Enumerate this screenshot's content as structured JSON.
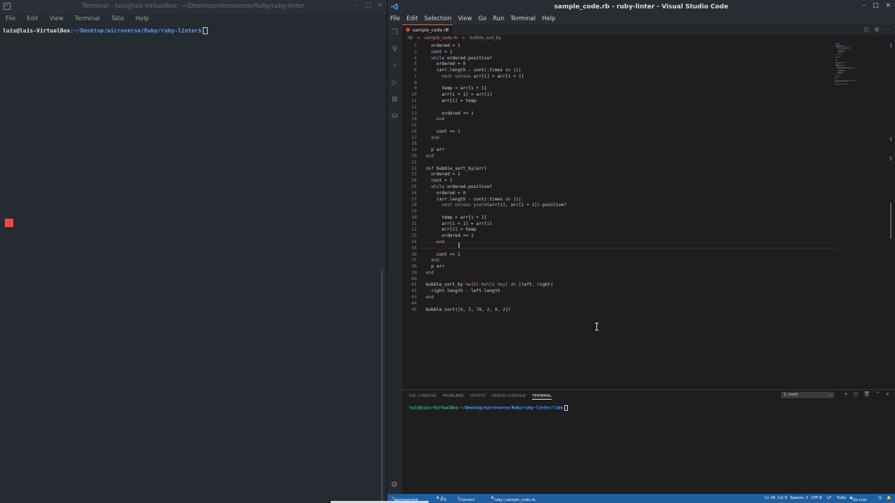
{
  "terminal_window": {
    "title": "Terminal - luis@luis-VirtualBox: ~/Desktop/microverse/Ruby/ruby-linter",
    "menu": [
      "File",
      "Edit",
      "View",
      "Terminal",
      "Tabs",
      "Help"
    ],
    "prompt_user": "luis@luis-VirtualBox",
    "prompt_path": ":~/Desktop/microverse/Ruby/ruby-linter$"
  },
  "vscode": {
    "title": "sample_code.rb - ruby-linter - Visual Studio Code",
    "menu": [
      "File",
      "Edit",
      "Selection",
      "View",
      "Go",
      "Run",
      "Terminal",
      "Help"
    ],
    "tab_label": "sample_code.rb",
    "tab_close": "×",
    "breadcrumb": [
      "lib",
      ">",
      "sample_code.rb",
      ">",
      "bubble_sort_by"
    ],
    "code_lines": [
      {
        "n": "2",
        "t": "  ordered = 1"
      },
      {
        "n": "3",
        "t": "  cont = 1"
      },
      {
        "n": "4",
        "t": "  while ordered.positive?"
      },
      {
        "n": "5",
        "t": "    ordered = 0"
      },
      {
        "n": "6",
        "t": "    (arr.length - cont).times do |i|"
      },
      {
        "n": "7",
        "t": "      next unless arr[i] > arr[i + 1]"
      },
      {
        "n": "8",
        "t": ""
      },
      {
        "n": "9",
        "t": "      temp = arr[i + 1]"
      },
      {
        "n": "10",
        "t": "      arr[i + 1] = arr[i]"
      },
      {
        "n": "11",
        "t": "      arr[i] = temp"
      },
      {
        "n": "12",
        "t": ""
      },
      {
        "n": "13",
        "t": "      ordered += 1"
      },
      {
        "n": "14",
        "t": "    end"
      },
      {
        "n": "15",
        "t": ""
      },
      {
        "n": "16",
        "t": "    cont += 1"
      },
      {
        "n": "17",
        "t": "  end"
      },
      {
        "n": "18",
        "t": ""
      },
      {
        "n": "19",
        "t": "  p arr"
      },
      {
        "n": "20",
        "t": "end"
      },
      {
        "n": "21",
        "t": ""
      },
      {
        "n": "22",
        "t": "def bubble_sort_by(arr)"
      },
      {
        "n": "23",
        "t": "  ordered = 1"
      },
      {
        "n": "24",
        "t": "  cont = 1"
      },
      {
        "n": "25",
        "t": "  while ordered.positive?"
      },
      {
        "n": "26",
        "t": "    ordered = 0"
      },
      {
        "n": "27",
        "t": "    (arr.length - cont).times do |i|"
      },
      {
        "n": "28",
        "t": "      next unless yield(arr[i], arr[i + 1]).positive?"
      },
      {
        "n": "29",
        "t": ""
      },
      {
        "n": "30",
        "t": "      temp = arr[i + 1]"
      },
      {
        "n": "31",
        "t": "      arr[i + 1] = arr[i]"
      },
      {
        "n": "32",
        "t": "      arr[i] = temp"
      },
      {
        "n": "33",
        "t": "      ordered += 1"
      },
      {
        "n": "34",
        "t": "    end"
      },
      {
        "n": "35",
        "t": ""
      },
      {
        "n": "36",
        "t": "    cont += 1"
      },
      {
        "n": "37",
        "t": "  end"
      },
      {
        "n": "38",
        "t": "  p arr"
      },
      {
        "n": "39",
        "t": "end"
      },
      {
        "n": "40",
        "t": ""
      },
      {
        "n": "41",
        "t": "bubble_sort_by %w[hi hello hey] do |left, right|"
      },
      {
        "n": "42",
        "t": "  right.length - left.length"
      },
      {
        "n": "43",
        "t": "end"
      },
      {
        "n": "44",
        "t": ""
      },
      {
        "n": "45",
        "t": "bubble_sort([4, 3, 78, 2, 0, 2])"
      }
    ],
    "panel": {
      "tabs": [
        "SQL CONSOLE",
        "PROBLEMS",
        "OUTPUT",
        "DEBUG CONSOLE",
        "TERMINAL"
      ],
      "terminal_select": "1: bash",
      "prompt_user": "luis@luis-VirtualBox",
      "prompt_path": ":~/Desktop/microverse/Ruby/ruby-linter/lib$"
    },
    "status": {
      "branch": "development",
      "errors": "0",
      "warnings": "0",
      "connect": "Connect",
      "lang_file": "ruby | sample_code.rb",
      "position": "Ln 34, Col 8",
      "spaces": "Spaces: 2",
      "encoding": "UTF-8",
      "eol": "LF",
      "language": "Ruby",
      "golive": "Go Live"
    }
  },
  "colors": {
    "accent_status": "#1f5fa0",
    "keyword": "#c586c0",
    "function": "#dcdcaa",
    "variable": "#9cdcfe",
    "number": "#b5cea8",
    "string": "#ce9178"
  }
}
